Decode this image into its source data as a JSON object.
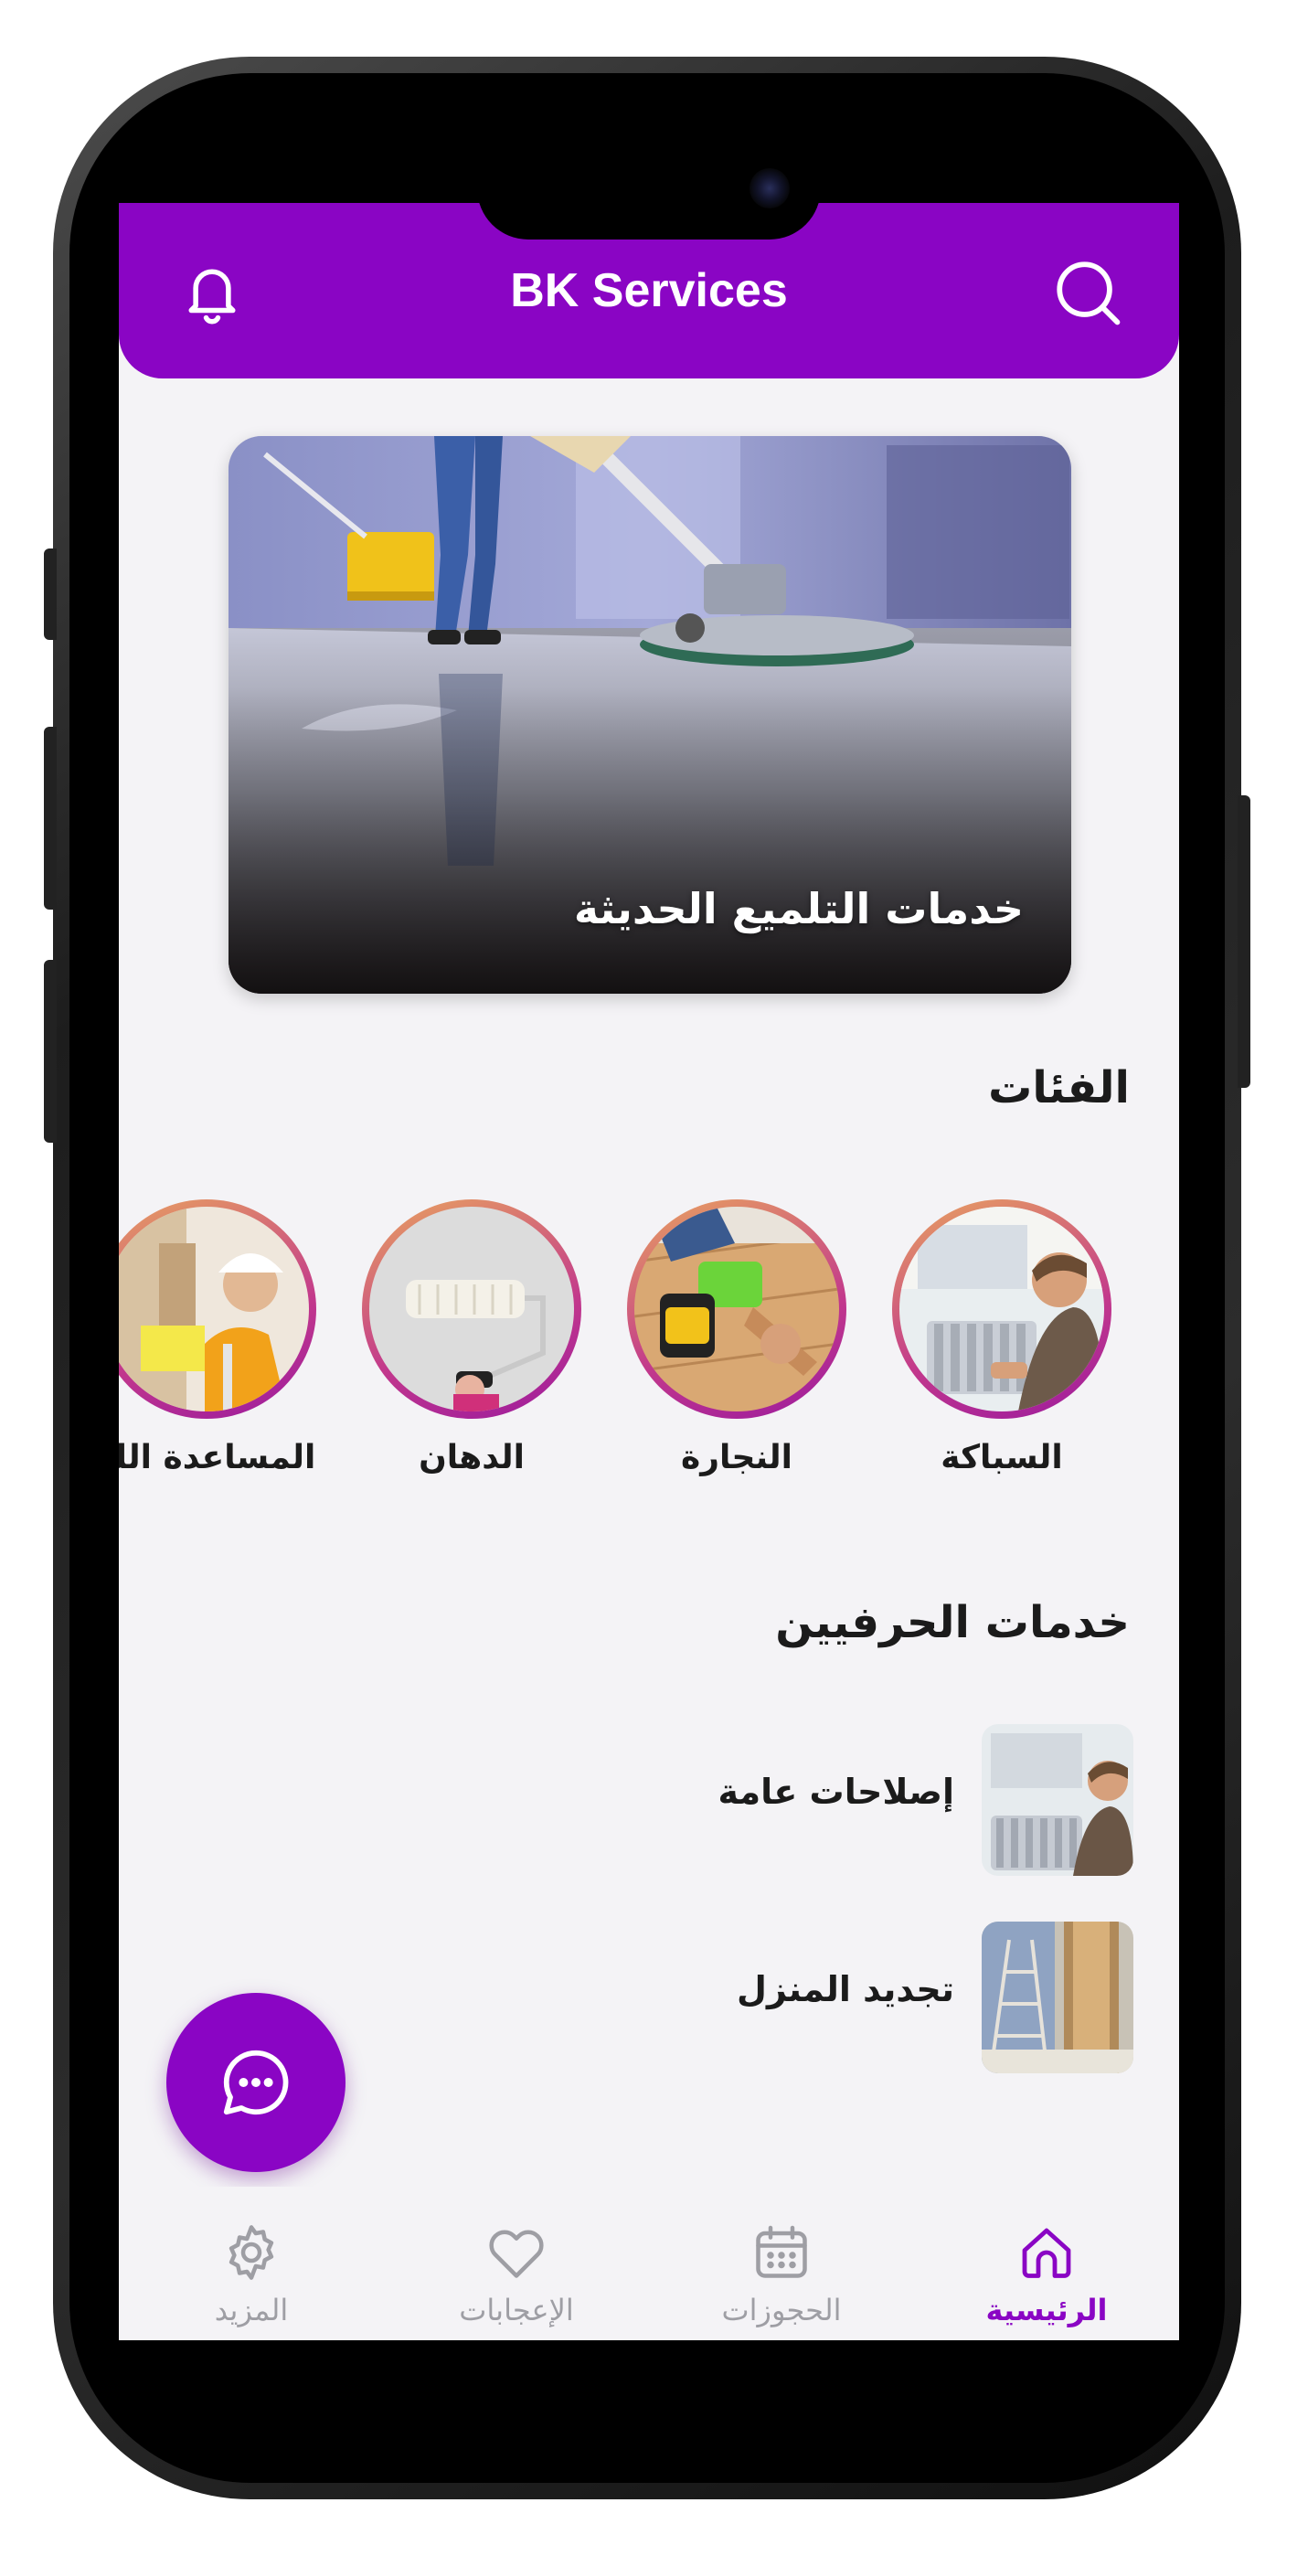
{
  "header": {
    "title": "BK Services",
    "left_icon": "bell-icon",
    "right_icon": "search-icon",
    "background_color": "#8a05c4"
  },
  "banner": {
    "caption": "خدمات التلميع الحديثة"
  },
  "categories": {
    "title": "الفئات",
    "items": [
      {
        "label": "السباكة",
        "image": "plumber-radiator-photo"
      },
      {
        "label": "النجارة",
        "image": "carpentry-drill-photo"
      },
      {
        "label": "الدهان",
        "image": "paint-roller-photo"
      },
      {
        "label": "المساعدة الك",
        "image": "construction-worker-photo"
      }
    ]
  },
  "crafts": {
    "title": "خدمات الحرفيين",
    "items": [
      {
        "label": "إصلاحات عامة",
        "image": "plumber-radiator-photo"
      },
      {
        "label": "تجديد المنزل",
        "image": "renovation-ladder-photo"
      }
    ]
  },
  "chat_button": {
    "icon": "chat-bubble-icon"
  },
  "bottom_nav": {
    "items": [
      {
        "label": "الرئيسية",
        "icon": "home-icon",
        "active": true
      },
      {
        "label": "الحجوزات",
        "icon": "calendar-icon",
        "active": false
      },
      {
        "label": "الإعجابات",
        "icon": "heart-icon",
        "active": false
      },
      {
        "label": "المزيد",
        "icon": "gear-icon",
        "active": false
      }
    ],
    "active_color": "#8a05c4",
    "inactive_color": "#9e9ea4"
  }
}
